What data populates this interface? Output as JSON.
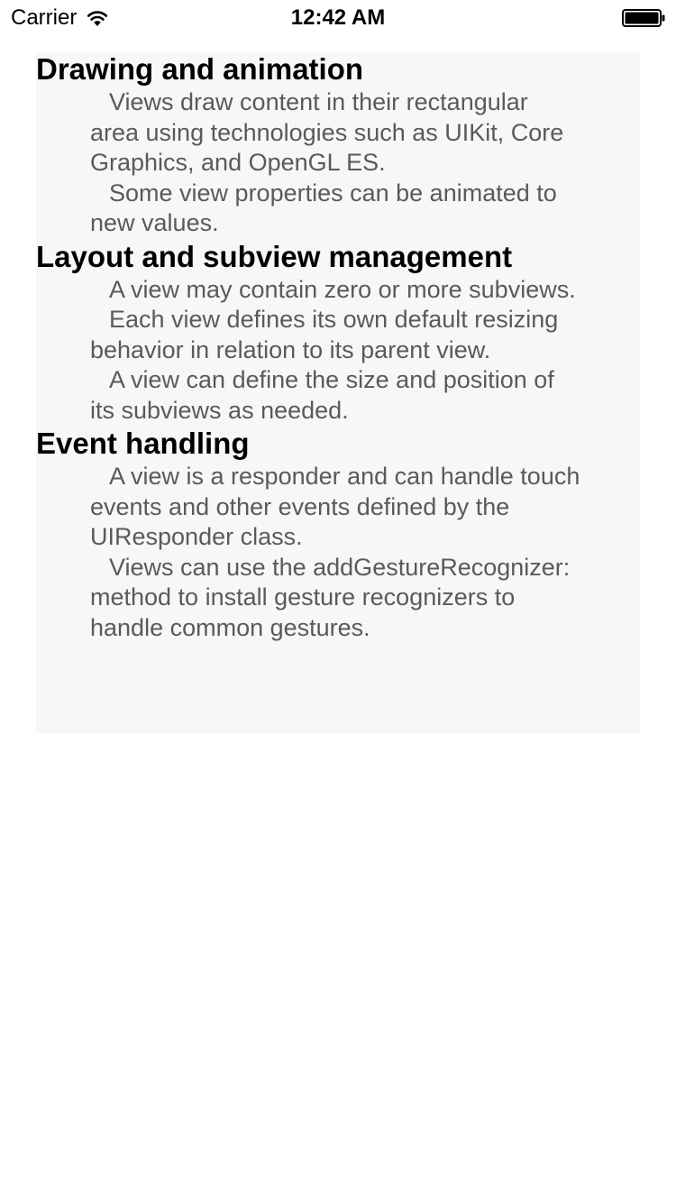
{
  "status_bar": {
    "carrier": "Carrier",
    "time": "12:42 AM",
    "wifi_icon": "wifi-icon",
    "battery_icon": "battery-icon"
  },
  "sections": [
    {
      "title": "Drawing and animation",
      "paragraphs": [
        "Views draw content in their rectangular area using technologies such as UIKit, Core Graphics, and OpenGL ES.",
        "Some view properties can be animated to new values."
      ]
    },
    {
      "title": "Layout and subview management",
      "paragraphs": [
        "A view may contain zero or more subviews.",
        "Each view defines its own default resizing behavior in relation to its parent view.",
        "A view can define the size and position of its subviews as needed."
      ]
    },
    {
      "title": "Event handling",
      "paragraphs": [
        "A view is a responder and can handle touch events and other events defined by the UIResponder class.",
        "Views can use the addGestureRecognizer: method to install gesture recognizers to handle common gestures."
      ]
    }
  ],
  "colors": {
    "panel_background": "#f7f7f7",
    "title_text": "#000000",
    "body_text": "#5a5a5a"
  }
}
